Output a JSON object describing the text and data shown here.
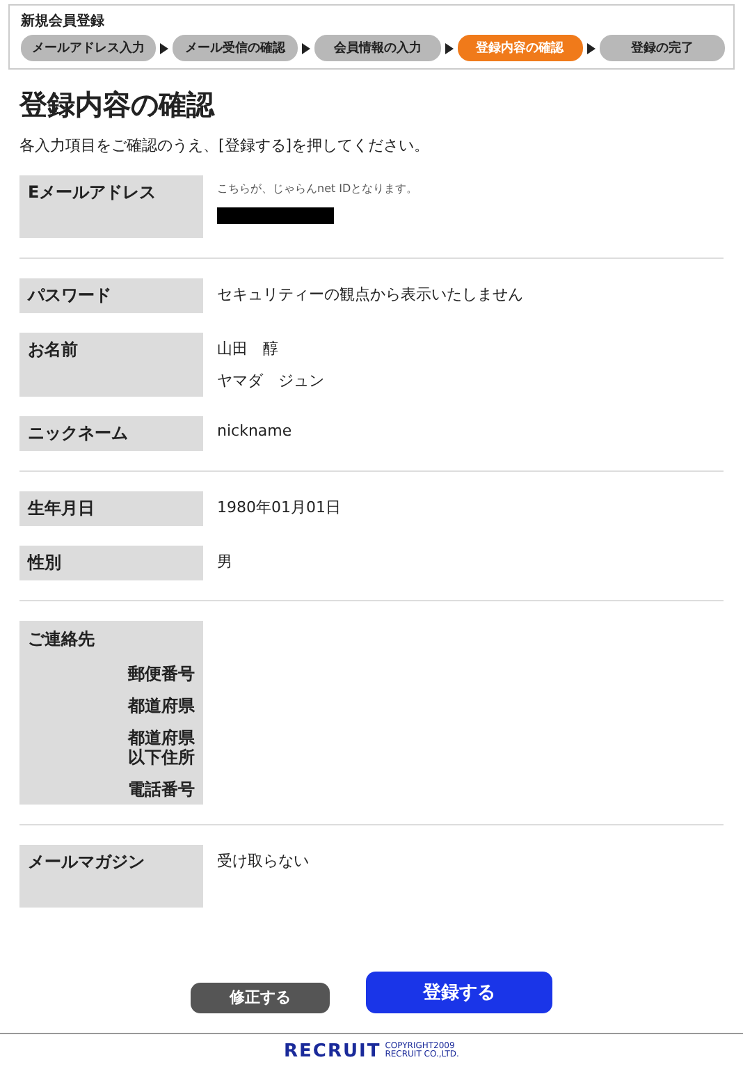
{
  "header": {
    "title": "新規会員登録",
    "steps": [
      {
        "label": "メールアドレス入力",
        "selected": false
      },
      {
        "label": "メール受信の確認",
        "selected": false
      },
      {
        "label": "会員情報の入力",
        "selected": false
      },
      {
        "label": "登録内容の確認",
        "selected": true
      },
      {
        "label": "登録の完了",
        "selected": false
      }
    ]
  },
  "page_title": "登録内容の確認",
  "instructions": "各入力項目をご確認のうえ、[登録する]を押してください。",
  "sections": [
    {
      "fields": [
        {
          "label": "Eメールアドレス",
          "note": "こちらが、じゃらんnet IDとなります。",
          "redacted": true
        }
      ]
    },
    {
      "fields": [
        {
          "label": "パスワード",
          "values": [
            "セキュリティーの観点から表示いたしません"
          ]
        },
        {
          "label": "お名前",
          "values": [
            "山田　醇",
            "ヤマダ　ジュン"
          ]
        },
        {
          "label": "ニックネーム",
          "values": [
            "nickname"
          ]
        }
      ]
    },
    {
      "fields": [
        {
          "label": "生年月日",
          "values": [
            "1980年01月01日"
          ]
        },
        {
          "label": "性別",
          "values": [
            "男"
          ]
        }
      ]
    },
    {
      "fields": [
        {
          "label": "ご連絡先",
          "sublabels": [
            "郵便番号",
            "都道府県",
            "都道府県以下住所",
            "電話番号"
          ]
        }
      ]
    },
    {
      "fields": [
        {
          "label": "メールマガジン",
          "values": [
            "受け取らない"
          ]
        }
      ]
    }
  ],
  "buttons": {
    "back": "修正する",
    "submit": "登録する"
  },
  "footer": {
    "logo": "RECRUIT",
    "copyright": [
      "COPYRIGHT2009",
      "RECRUIT CO.,LTD."
    ]
  }
}
